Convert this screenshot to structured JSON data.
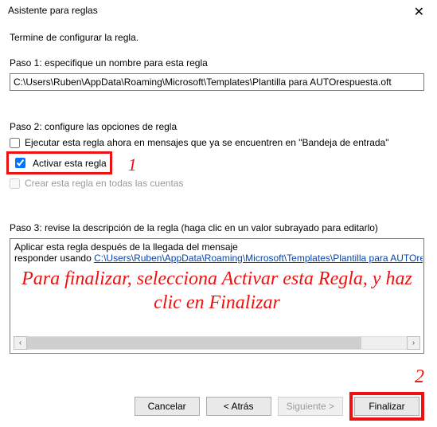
{
  "window": {
    "title": "Asistente para reglas",
    "close_glyph": "✕"
  },
  "subtitle": "Termine de configurar la regla.",
  "step1": {
    "label": "Paso 1: especifique un nombre para esta regla",
    "value": "C:\\Users\\Ruben\\AppData\\Roaming\\Microsoft\\Templates\\Plantilla para AUTOrespuesta.oft"
  },
  "step2": {
    "label": "Paso 2: configure las opciones de regla",
    "opt_run_now": "Ejecutar esta regla ahora en mensajes que ya se encuentren en \"Bandeja de entrada\"",
    "opt_activate": "Activar esta regla",
    "opt_all_accounts": "Crear esta regla en todas las cuentas"
  },
  "annotations": {
    "one": "1",
    "two": "2",
    "overlay": "Para finalizar, selecciona Activar esta Regla, y haz clic en Finalizar"
  },
  "step3": {
    "label": "Paso 3: revise la descripción de la regla (haga clic en un valor subrayado para editarlo)",
    "line1": "Aplicar esta regla después de la llegada del mensaje",
    "line2_prefix": "responder usando ",
    "line2_link": "C:\\Users\\Ruben\\AppData\\Roaming\\Microsoft\\Templates\\Plantilla para AUTOrespue"
  },
  "scroll": {
    "left_glyph": "‹",
    "right_glyph": "›"
  },
  "buttons": {
    "cancel": "Cancelar",
    "back": "< Atrás",
    "next": "Siguiente >",
    "finish": "Finalizar"
  }
}
